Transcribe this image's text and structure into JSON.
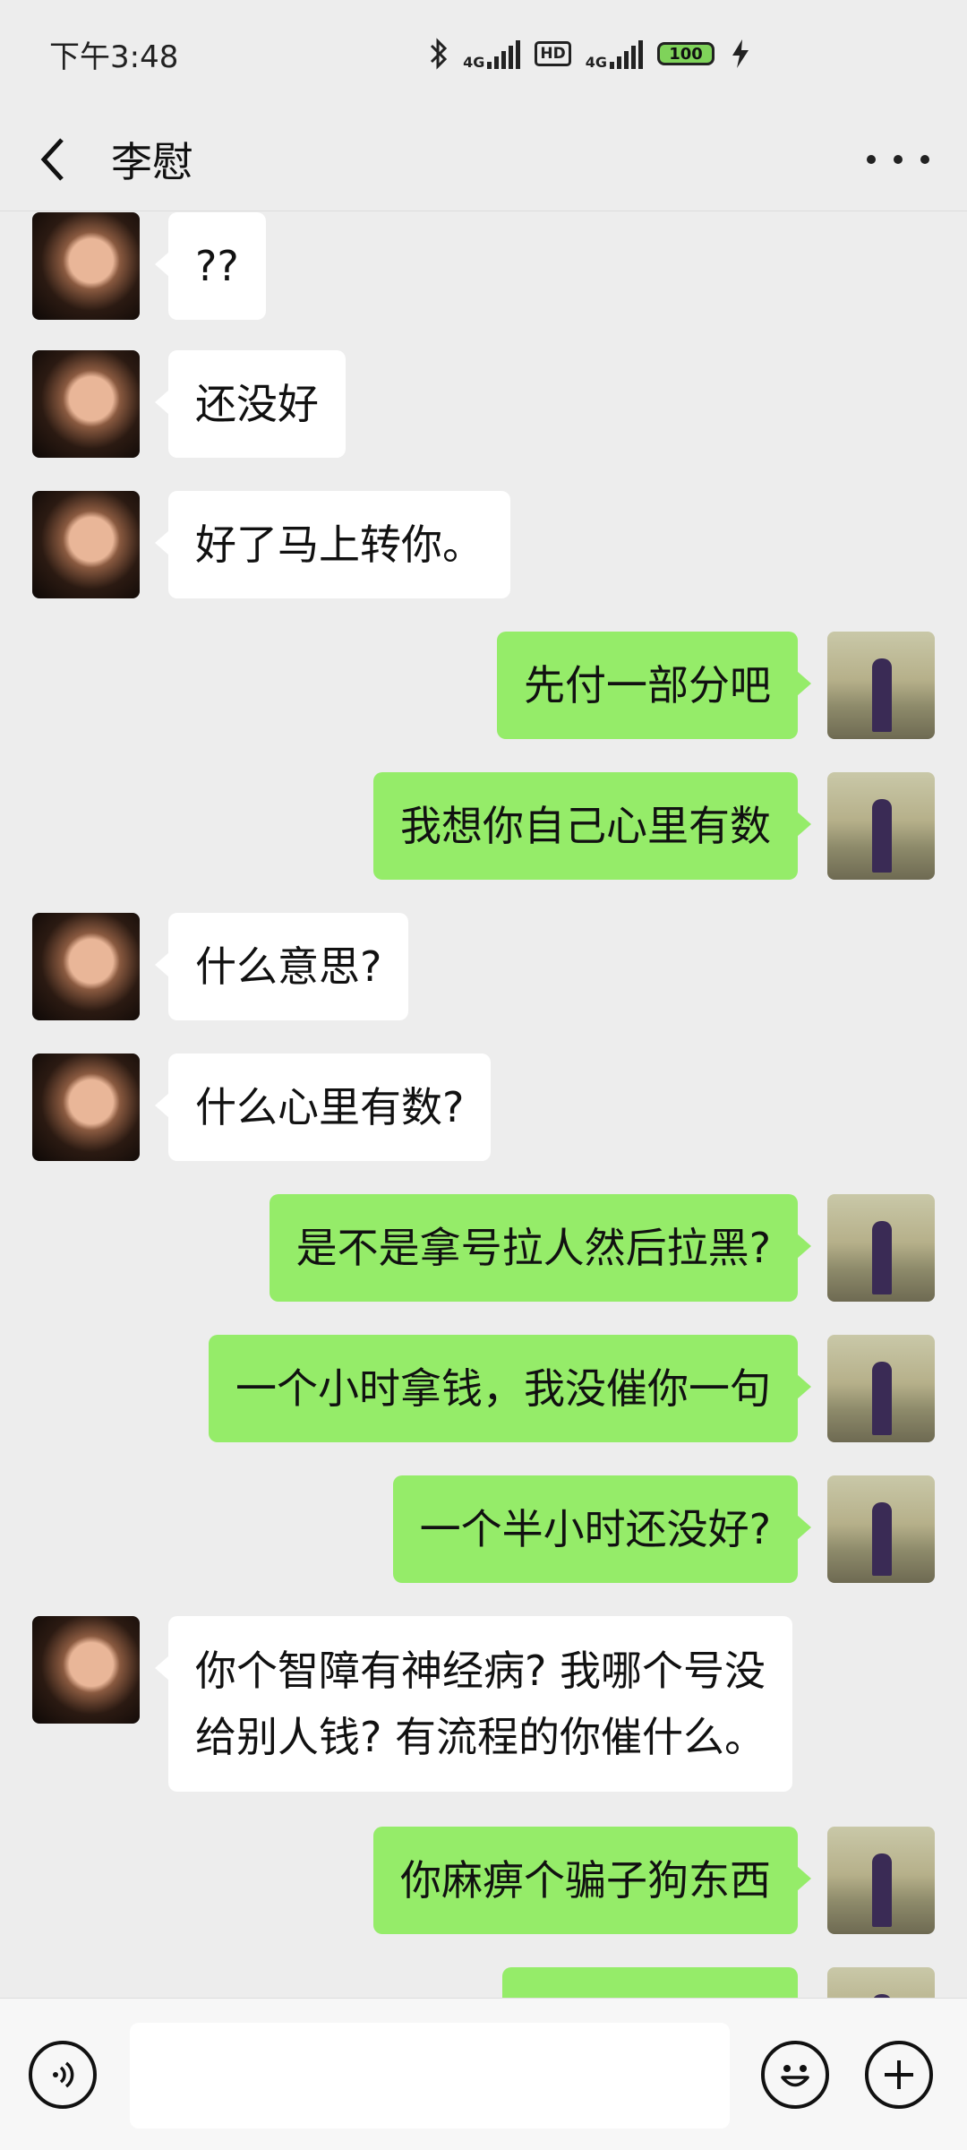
{
  "status_bar": {
    "time": "下午3:48",
    "net1": "4G",
    "hd": "HD",
    "net2": "4G",
    "battery": "100"
  },
  "header": {
    "title": "李慰"
  },
  "messages": [
    {
      "side": "left",
      "text": "??"
    },
    {
      "side": "left",
      "text": "还没好"
    },
    {
      "side": "left",
      "text": "好了马上转你。"
    },
    {
      "side": "right",
      "text": "先付一部分吧"
    },
    {
      "side": "right",
      "text": "我想你自己心里有数"
    },
    {
      "side": "left",
      "text": "什么意思?"
    },
    {
      "side": "left",
      "text": "什么心里有数?"
    },
    {
      "side": "right",
      "text": "是不是拿号拉人然后拉黑?"
    },
    {
      "side": "right",
      "text": "一个小时拿钱，我没催你一句"
    },
    {
      "side": "right",
      "text": "一个半小时还没好?"
    },
    {
      "side": "left",
      "text": "你个智障有神经病? 我哪个号没\n给别人钱? 有流程的你催什么。"
    },
    {
      "side": "right",
      "text": "你麻痹个骗子狗东西"
    }
  ]
}
